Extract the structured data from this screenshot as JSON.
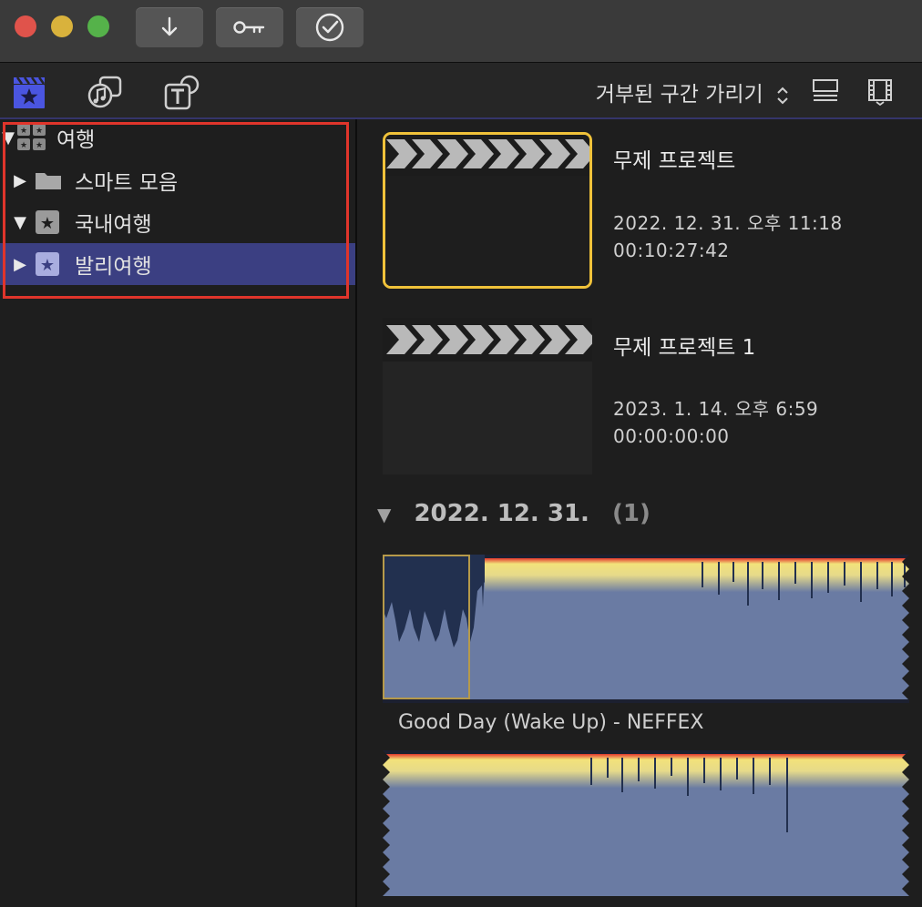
{
  "window": {
    "traffic_lights": [
      "#e0534b",
      "#d9b23c",
      "#55b24a"
    ],
    "toolbar_buttons": [
      "import-icon",
      "key-icon",
      "checkmark-icon"
    ]
  },
  "toolbar": {
    "icons": [
      "clapper-star-icon",
      "music-photo-icon",
      "titles-icon"
    ],
    "filter_label": "거부된 구간 가리기",
    "view_icons": [
      "list-view-icon",
      "filmstrip-view-icon"
    ],
    "accent": "#4a55e0"
  },
  "sidebar": {
    "items": [
      {
        "label": "여행",
        "icon": "event-library-icon",
        "expanded": true
      },
      {
        "label": "스마트 모음",
        "icon": "folder-icon",
        "expanded": false
      },
      {
        "label": "국내여행",
        "icon": "star-event-icon",
        "expanded": true
      },
      {
        "label": "발리여행",
        "icon": "star-event-icon",
        "expanded": false,
        "selected": true
      }
    ]
  },
  "projects": [
    {
      "title": "무제 프로젝트",
      "date": "2022. 12. 31. 오후 11:18",
      "duration": "00:10:27:42",
      "selected": true
    },
    {
      "title": "무제 프로젝트 1",
      "date": "2023. 1. 14. 오후 6:59",
      "duration": "00:00:00:00",
      "selected": false
    }
  ],
  "date_group": {
    "label": "2022. 12. 31.",
    "count": "(1)"
  },
  "clips": [
    {
      "name": "Good Day (Wake Up) - NEFFEX"
    }
  ],
  "colors": {
    "selection": "#3b3f82",
    "project_highlight": "#f0c23a",
    "waveform_fill": "#6a7ba3",
    "waveform_dark": "#22304f",
    "peak_yellow": "#f2e27a",
    "peak_red": "#e3392e",
    "annotation_red": "#e0352b"
  }
}
